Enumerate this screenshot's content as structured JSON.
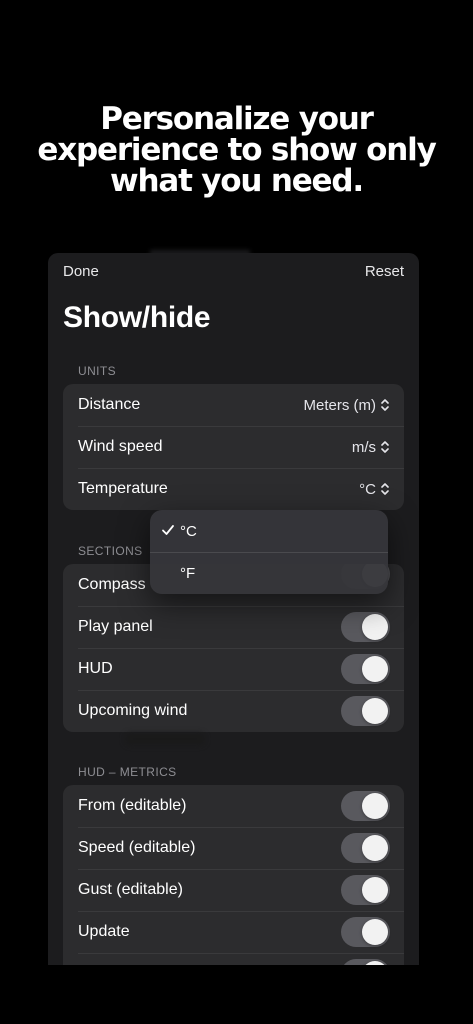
{
  "headline": {
    "line1": "Personalize your",
    "line2": "experience to show only",
    "line3": "what you need."
  },
  "nav": {
    "done_label": "Done",
    "reset_label": "Reset"
  },
  "title": "Show/hide",
  "units": {
    "header": "UNITS",
    "rows": [
      {
        "label": "Distance",
        "value": "Meters (m)"
      },
      {
        "label": "Wind speed",
        "value": "m/s"
      },
      {
        "label": "Temperature",
        "value": "°C"
      }
    ]
  },
  "temperature_menu": {
    "options": [
      {
        "label": "°C",
        "selected": true
      },
      {
        "label": "°F",
        "selected": false
      }
    ]
  },
  "sections": {
    "header": "SECTIONS",
    "rows": [
      {
        "label": "Compass",
        "on": true
      },
      {
        "label": "Play panel",
        "on": true
      },
      {
        "label": "HUD",
        "on": true
      },
      {
        "label": "Upcoming wind",
        "on": true
      }
    ]
  },
  "hud_metrics": {
    "header": "HUD – METRICS",
    "rows": [
      {
        "label": "From (editable)",
        "on": true
      },
      {
        "label": "Speed (editable)",
        "on": true
      },
      {
        "label": "Gust (editable)",
        "on": true
      },
      {
        "label": "Update",
        "on": true
      }
    ]
  },
  "colors": {
    "background": "#000000",
    "panel": "#1c1c1e",
    "group": "#2c2c2e",
    "toggle_track": "#59595e",
    "secondary_text": "#8e8e93"
  }
}
